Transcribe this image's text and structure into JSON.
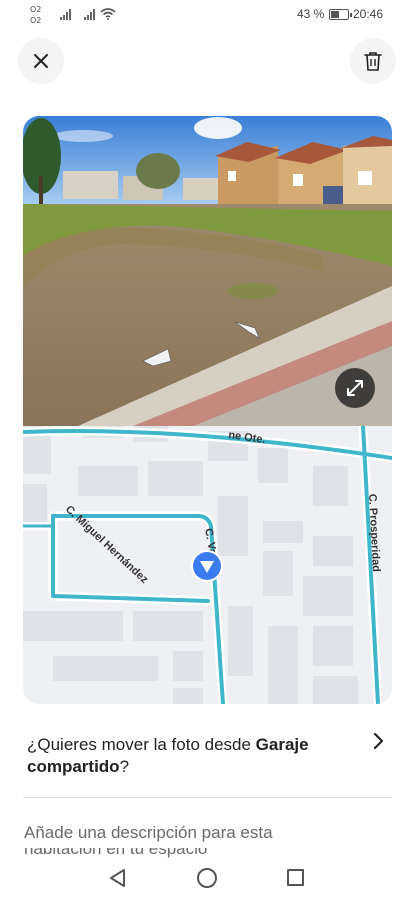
{
  "status_bar": {
    "carrier_1": "O2",
    "carrier_2": "O2",
    "battery_percent": "43 %",
    "battery_level": 0.43,
    "time": "20:46"
  },
  "header": {
    "close_icon": "close-icon",
    "delete_icon": "trash-icon"
  },
  "media": {
    "photo_icon": "expand-icon",
    "map_labels": {
      "street_1": "C. Miguel Hernández",
      "street_2": "C. Vallejo",
      "street_3": "C. Prosperidad",
      "street_4": "ne Ote."
    }
  },
  "move_photo": {
    "prefix": "¿Quieres mover la foto desde ",
    "room": "Garaje compartido",
    "suffix": "?"
  },
  "description": {
    "line_1": "Añade una descripción para esta",
    "line_2": "habitación en tu espacio"
  },
  "colors": {
    "road": "#3fb6c9",
    "map_bg": "#eef0f3",
    "building": "#dfe2e7",
    "marker": "#3a7bf0"
  }
}
